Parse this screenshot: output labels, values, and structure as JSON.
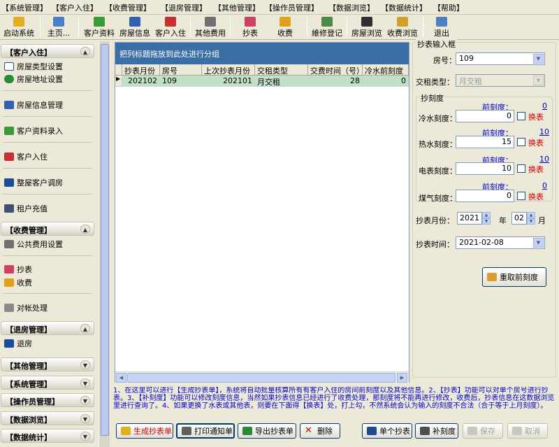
{
  "menu": [
    "【系统管理】",
    "【客户入住】",
    "【收费管理】",
    "【退房管理】",
    "【其他管理】",
    "【操作员管理】",
    "【数据浏览】",
    "【数据统计】",
    "【帮助】"
  ],
  "toolbar": [
    {
      "label": "启动系统",
      "icon": "key-icon"
    },
    {
      "label": "主页...",
      "icon": "home-icon"
    },
    {
      "label": "客户资料",
      "icon": "customer-icon"
    },
    {
      "label": "房屋信息",
      "icon": "house-info-icon"
    },
    {
      "label": "客户入住",
      "icon": "checkin-icon"
    },
    {
      "label": "其他费用",
      "icon": "fee-icon"
    },
    {
      "label": "抄表",
      "icon": "meter-icon"
    },
    {
      "label": "收费",
      "icon": "charge-icon"
    },
    {
      "label": "維修登记",
      "icon": "repair-icon"
    },
    {
      "label": "房屋浏览",
      "icon": "browse-icon"
    },
    {
      "label": "收费浏览",
      "icon": "charge-browse-icon"
    },
    {
      "label": "退出",
      "icon": "exit-icon"
    }
  ],
  "sidebar": {
    "checkin": {
      "title": "【客户入住】",
      "items": [
        "房屋类型设置",
        "房屋地址设置",
        "房屋信息管理",
        "客户资料录入",
        "客户入住",
        "整屋客户调房",
        "租户充值"
      ]
    },
    "charge": {
      "title": "【收费管理】",
      "items": [
        "公共费用设置",
        "抄表",
        "收费",
        "对帐处理"
      ]
    },
    "checkout": {
      "title": "【退房管理】",
      "items": [
        "退房"
      ]
    },
    "collapsed": [
      "【其他管理】",
      "【系统管理】",
      "【操作员管理】",
      "【数据浏览】",
      "【数据统计】"
    ]
  },
  "grid": {
    "group_hint": "把列标题拖放到此处进行分组",
    "columns": [
      "抄表月份",
      "房号",
      "上次抄表月份",
      "交租类型",
      "交费时间（号）",
      "冷水前刻度"
    ],
    "rows": [
      [
        "202102",
        "109",
        "202101",
        "月交租",
        "28",
        "0"
      ]
    ]
  },
  "panel": {
    "title": "抄表输入框",
    "room_label": "房号：",
    "room_value": "109",
    "rent_type_label": "交租类型：",
    "rent_type_value": "月交租",
    "reading_group": "抄刻度",
    "prev_label": "前刻度：",
    "replace_label": "换表",
    "meters": [
      {
        "label": "冷水刻度：",
        "prev": "0",
        "value": "0"
      },
      {
        "label": "热水刻度：",
        "prev": "10",
        "value": "15"
      },
      {
        "label": "电表刻度：",
        "prev": "10",
        "value": "10"
      },
      {
        "label": "煤气刻度：",
        "prev": "0",
        "value": "0"
      }
    ],
    "month_label": "抄表月份：",
    "year_value": "2021",
    "year_unit": "年",
    "month_value": "02",
    "month_unit": "月",
    "time_label": "抄表时间：",
    "time_value": "2021-02-08",
    "reload_button": "重取前刻度"
  },
  "hint": "1、在这里可以进行【生成抄表单】，系统将自动批量核算所有有客户入住的房间前刻度以及其他信息。2、【抄表】功能可以对单个房号进行抄表。3、【补刻度】功能可以修改刻度信息，当然如果抄表信息已经进行了收费处理，那刻度将不能再进行修改，收费后，抄表信息在这数据浏览里进行查询了。4、如果更换了水表或其他表，则要在下面得【换表】处，打上勾，不然系统会认为输入的刻度不合法（合于等于上月刻度）。",
  "bottom_buttons": {
    "generate": "生成抄表单",
    "print": "打印通知单",
    "export": "导出抄表单",
    "delete": "删除",
    "single": "单个抄表",
    "supplement": "补刻度",
    "save": "保存",
    "cancel": "取消"
  }
}
